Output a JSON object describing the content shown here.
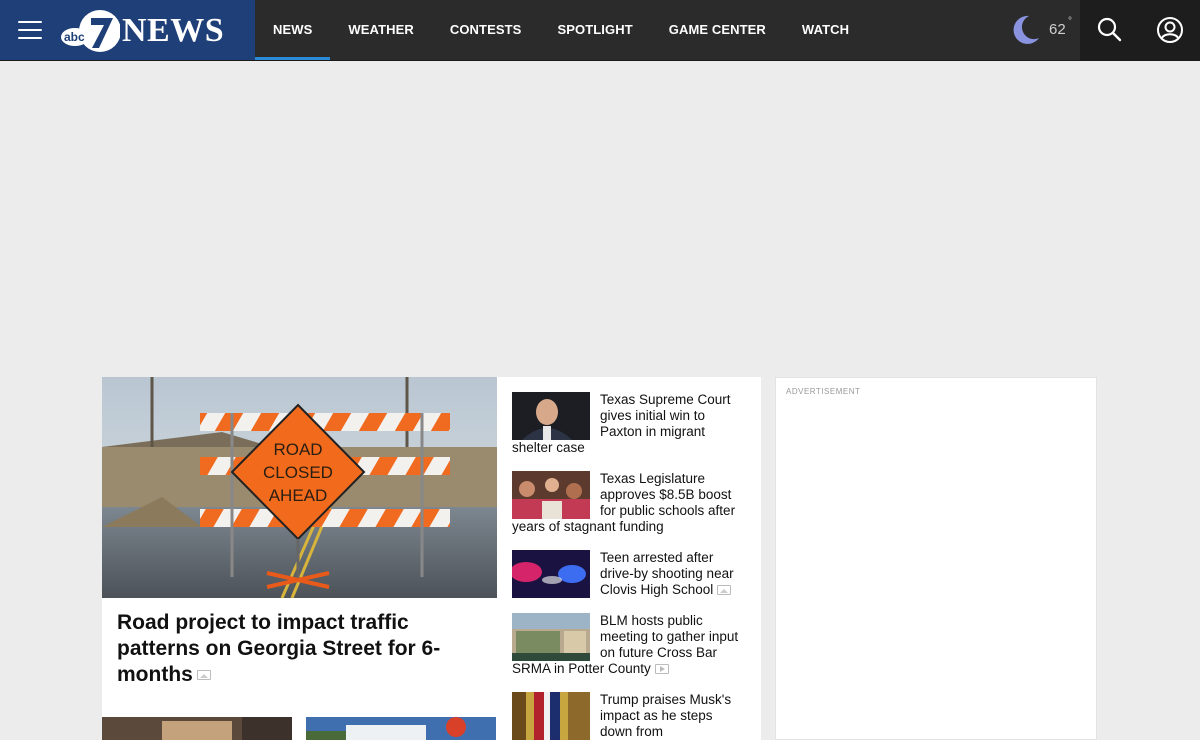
{
  "brand": {
    "logo_text": "NEWS",
    "logo_mark_text": "abc",
    "logo_mark_number": "7",
    "bg_color": "#1e3f78"
  },
  "nav": {
    "items": [
      {
        "label": "NEWS",
        "active": true
      },
      {
        "label": "WEATHER",
        "active": false
      },
      {
        "label": "CONTESTS",
        "active": false
      },
      {
        "label": "SPOTLIGHT",
        "active": false
      },
      {
        "label": "GAME CENTER",
        "active": false
      },
      {
        "label": "WATCH",
        "active": false
      }
    ],
    "active_indicator_color": "#2a8ad6"
  },
  "weather": {
    "icon": "moon-icon",
    "temperature": "62",
    "degree_symbol": "°"
  },
  "tools": {
    "search_icon": "search-icon",
    "account_icon": "account-icon"
  },
  "feature": {
    "headline": "Road project to impact traffic patterns on Georgia Street for 6-months",
    "media_type_icon": "gallery-icon",
    "image_sign_lines": [
      "ROAD",
      "CLOSED",
      "AHEAD"
    ]
  },
  "stories": [
    {
      "title": "Texas Supreme Court gives initial win to Paxton in migrant shelter case",
      "media_icon": ""
    },
    {
      "title": "Texas Legislature approves $8.5B boost for public schools after years of stagnant funding",
      "media_icon": ""
    },
    {
      "title": "Teen arrested after drive-by shooting near Clovis High School",
      "media_icon": "gallery-icon"
    },
    {
      "title": "BLM hosts public meeting to gather input on future Cross Bar SRMA in Potter County",
      "media_icon": "video-icon"
    },
    {
      "title": "Trump praises Musk's impact as he steps down from",
      "media_icon": ""
    }
  ],
  "ad": {
    "label": "ADVERTISEMENT"
  }
}
